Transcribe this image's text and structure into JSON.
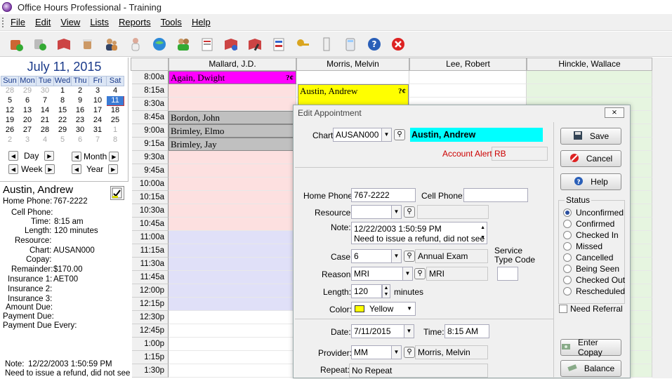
{
  "window": {
    "title": "Office Hours Professional - Training"
  },
  "menu": {
    "file": "File",
    "edit": "Edit",
    "view": "View",
    "lists": "Lists",
    "reports": "Reports",
    "tools": "Tools",
    "help": "Help"
  },
  "toolbar_icons": [
    "new-appointment-icon",
    "find-icon",
    "book-icon",
    "cup-icon",
    "users-icon",
    "patient-icon",
    "world-icon",
    "group-icon",
    "document-icon",
    "appointment-book-icon",
    "edit-book-icon",
    "report-icon",
    "key-icon",
    "column-icon",
    "calculator-icon",
    "help-icon",
    "exit-icon"
  ],
  "calendar": {
    "title": "July 11, 2015",
    "days": [
      "Sun",
      "Mon",
      "Tue",
      "Wed",
      "Thu",
      "Fri",
      "Sat"
    ],
    "weeks": [
      [
        "28",
        "29",
        "30",
        "1",
        "2",
        "3",
        "4"
      ],
      [
        "5",
        "6",
        "7",
        "8",
        "9",
        "10",
        "11"
      ],
      [
        "12",
        "13",
        "14",
        "15",
        "16",
        "17",
        "18"
      ],
      [
        "19",
        "20",
        "21",
        "22",
        "23",
        "24",
        "25"
      ],
      [
        "26",
        "27",
        "28",
        "29",
        "30",
        "31",
        "1"
      ],
      [
        "2",
        "3",
        "4",
        "5",
        "6",
        "7",
        "8"
      ]
    ],
    "nav": {
      "day": "Day",
      "month": "Month",
      "week": "Week",
      "year": "Year"
    }
  },
  "patient": {
    "name": "Austin, Andrew",
    "home_phone_label": "Home Phone:",
    "home_phone": "767-2222",
    "cell_phone_label": "Cell Phone:",
    "time_label": "Time:",
    "time": "8:15 am",
    "length_label": "Length:",
    "length": "120 minutes",
    "resource_label": "Resource:",
    "chart_label": "Chart:",
    "chart": "AUSAN000",
    "copay_label": "Copay:",
    "remainder_label": "Remainder:",
    "remainder": "$170.00",
    "ins1_label": "Insurance 1:",
    "ins1": "AET00",
    "ins2_label": "Insurance 2:",
    "ins3_label": "Insurance 3:",
    "amount_due_label": "Amount Due:",
    "payment_due_label": "Payment Due:",
    "payment_due_every_label": "Payment Due Every:",
    "note_label": "Note:",
    "note": "12/22/2003 1:50:59 PM",
    "note2": "Need to issue a refund, did not see"
  },
  "schedule": {
    "columns": [
      "Mallard, J.D.",
      "Morris, Melvin",
      "Lee, Robert",
      "Hinckle, Wallace"
    ],
    "times": [
      "8:00a",
      "8:15a",
      "8:30a",
      "8:45a",
      "9:00a",
      "9:15a",
      "9:30a",
      "9:45a",
      "10:00a",
      "10:15a",
      "10:30a",
      "10:45a",
      "11:00a",
      "11:15a",
      "11:30a",
      "11:45a",
      "12:00p",
      "12:15p",
      "12:30p",
      "12:45p",
      "1:00p",
      "1:15p",
      "1:30p"
    ],
    "appointments": [
      {
        "name": "Again, Dwight",
        "mark": "?¢",
        "color": "#ff00ff"
      },
      {
        "name": "Austin, Andrew",
        "mark": "?¢",
        "color": "#ffff00"
      },
      {
        "name": "Bordon, John",
        "color": "#c0c0c0"
      },
      {
        "name": "Brimley, Elmo",
        "color": "#c0c0c0"
      },
      {
        "name": "Brimley, Jay",
        "color": "#c0c0c0"
      }
    ]
  },
  "dialog": {
    "title": "Edit Appointment",
    "chart_label": "Chart:",
    "chart": "AUSAN000",
    "patient_name": "Austin, Andrew",
    "account_alert_label": "Account Alert",
    "account_alert": "RB",
    "home_phone_label": "Home Phone:",
    "home_phone": "767-2222",
    "cell_phone_label": "Cell Phone:",
    "cell_phone": "",
    "resource_label": "Resource:",
    "resource": "",
    "note_label": "Note:",
    "note_line1": "12/22/2003 1:50:59 PM",
    "note_line2": "Need to issue a refund, did not see",
    "case_label": "Case:",
    "case": "6",
    "case_desc": "Annual Exam",
    "service_type_label1": "Service",
    "service_type_label2": "Type Code",
    "reason_label": "Reason:",
    "reason": "MRI",
    "reason_desc": "MRI",
    "length_label": "Length:",
    "length": "120",
    "minutes": "minutes",
    "color_label": "Color:",
    "color_name": "Yellow",
    "color_hex": "#ffff00",
    "date_label": "Date:",
    "date": "7/11/2015",
    "time_label": "Time:",
    "time": "8:15 AM",
    "provider_label": "Provider:",
    "provider": "MM",
    "provider_name": "Morris, Melvin",
    "repeat_label": "Repeat:",
    "repeat": "No Repeat",
    "save": "Save",
    "cancel": "Cancel",
    "help": "Help",
    "status_label": "Status",
    "statuses": [
      "Unconfirmed",
      "Confirmed",
      "Checked In",
      "Missed",
      "Cancelled",
      "Being Seen",
      "Checked Out",
      "Rescheduled"
    ],
    "selected_status": 0,
    "need_referral": "Need Referral",
    "enter_copay": "Enter Copay",
    "balance": "Balance"
  },
  "colors": {
    "accent": "#1a3a8a",
    "morning_fill": "#fde0e0",
    "midday_fill": "#e0e0f8",
    "hinckle_fill": "#e6f5e0",
    "patient_name_fill": "#00ffff",
    "alert_text": "#cc0000"
  }
}
